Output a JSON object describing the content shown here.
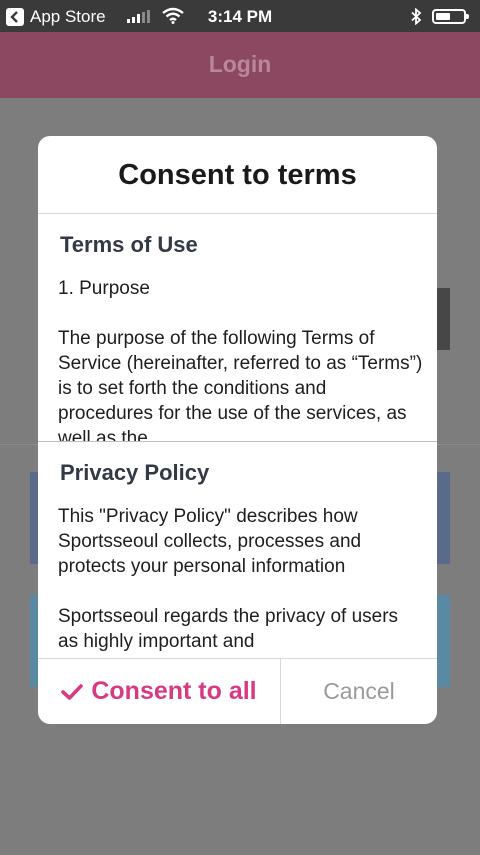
{
  "status_bar": {
    "back_app": "App Store",
    "time": "3:14 PM"
  },
  "nav": {
    "title": "Login"
  },
  "dialog": {
    "title": "Consent to terms",
    "terms": {
      "heading": "Terms of Use",
      "paragraphs": [
        "1. Purpose",
        "The purpose of the following Terms of Service (hereinafter, referred to as “Terms”) is to set forth the conditions and procedures for the use of the services, as well as the"
      ]
    },
    "privacy": {
      "heading": "Privacy Policy",
      "paragraphs": [
        "This \"Privacy Policy\" describes how Sportsseoul collects, processes and protects your personal information",
        "Sportsseoul regards the privacy of users as highly important and"
      ]
    },
    "buttons": {
      "consent_label": "Consent to all",
      "cancel_label": "Cancel"
    }
  },
  "colors": {
    "accent": "#d63a83",
    "nav_bar": "#8b4860",
    "overlay": "#7d7d7d"
  }
}
